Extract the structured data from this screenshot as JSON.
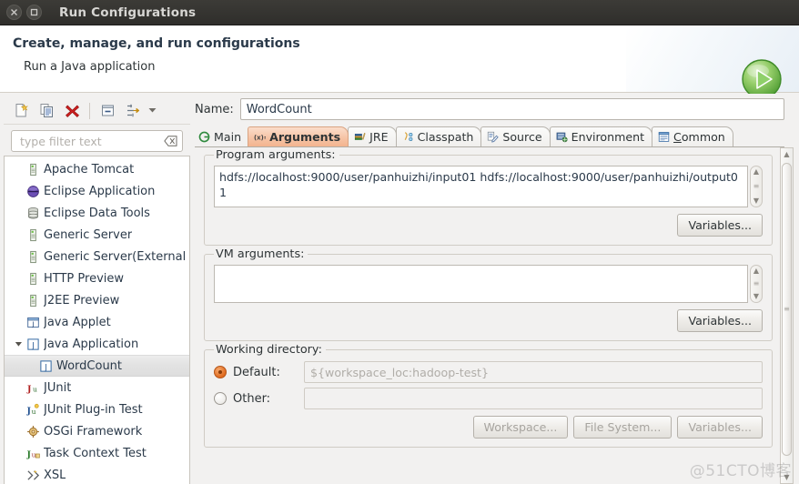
{
  "window": {
    "title": "Run Configurations",
    "close_icon": "close-icon",
    "maximize_icon": "maximize-icon"
  },
  "header": {
    "title": "Create, manage, and run configurations",
    "subtitle": "Run a Java application",
    "banner_icon": "run-play-icon"
  },
  "toolbar": {
    "buttons": [
      {
        "name": "new-configuration",
        "icon": "new-document-icon"
      },
      {
        "name": "duplicate-configuration",
        "icon": "copy-icon"
      },
      {
        "name": "delete-configuration",
        "icon": "red-x-delete-icon"
      },
      {
        "name": "collapse-all",
        "icon": "collapse-all-icon"
      },
      {
        "name": "filter-configurations",
        "icon": "filter-icon"
      }
    ],
    "dropdown_icon": "chevron-down-icon"
  },
  "filter": {
    "placeholder": "type filter text",
    "value": "",
    "clear_icon": "clear-field-icon"
  },
  "tree": {
    "items": [
      {
        "label": "Apache Tomcat",
        "icon": "server-icon",
        "indent": 0,
        "twisty": "",
        "selected": false
      },
      {
        "label": "Eclipse Application",
        "icon": "eclipse-icon",
        "indent": 0,
        "twisty": "",
        "selected": false
      },
      {
        "label": "Eclipse Data Tools",
        "icon": "database-icon",
        "indent": 0,
        "twisty": "",
        "selected": false
      },
      {
        "label": "Generic Server",
        "icon": "server-icon",
        "indent": 0,
        "twisty": "",
        "selected": false
      },
      {
        "label": "Generic Server(External",
        "icon": "server-icon",
        "indent": 0,
        "twisty": "",
        "selected": false
      },
      {
        "label": "HTTP Preview",
        "icon": "server-icon",
        "indent": 0,
        "twisty": "",
        "selected": false
      },
      {
        "label": "J2EE Preview",
        "icon": "server-icon",
        "indent": 0,
        "twisty": "",
        "selected": false
      },
      {
        "label": "Java Applet",
        "icon": "java-applet-icon",
        "indent": 0,
        "twisty": "",
        "selected": false
      },
      {
        "label": "Java Application",
        "icon": "java-app-icon",
        "indent": 0,
        "twisty": "expanded",
        "selected": false
      },
      {
        "label": "WordCount",
        "icon": "java-app-icon",
        "indent": 1,
        "twisty": "",
        "selected": true
      },
      {
        "label": "JUnit",
        "icon": "junit-icon",
        "indent": 0,
        "twisty": "",
        "selected": false
      },
      {
        "label": "JUnit Plug-in Test",
        "icon": "junit-plugin-icon",
        "indent": 0,
        "twisty": "",
        "selected": false
      },
      {
        "label": "OSGi Framework",
        "icon": "osgi-icon",
        "indent": 0,
        "twisty": "",
        "selected": false
      },
      {
        "label": "Task Context Test",
        "icon": "task-context-icon",
        "indent": 0,
        "twisty": "",
        "selected": false
      },
      {
        "label": "XSL",
        "icon": "xsl-icon",
        "indent": 0,
        "twisty": "",
        "selected": false
      }
    ]
  },
  "config": {
    "name_label": "Name:",
    "name_value": "WordCount",
    "tabs": [
      {
        "label": "Main",
        "icon": "main-icon",
        "active": false
      },
      {
        "label": "Arguments",
        "icon": "arguments-icon",
        "active": true
      },
      {
        "label": "JRE",
        "icon": "jre-icon",
        "active": false
      },
      {
        "label": "Classpath",
        "icon": "classpath-icon",
        "active": false
      },
      {
        "label": "Source",
        "icon": "source-icon",
        "active": false
      },
      {
        "label": "Environment",
        "icon": "environment-icon",
        "active": false
      },
      {
        "label": "Common",
        "icon": "common-icon",
        "active": false
      }
    ],
    "program_arguments": {
      "legend": "Program arguments:",
      "value": "hdfs://localhost:9000/user/panhuizhi/input01 hdfs://localhost:9000/user/panhuizhi/output01",
      "variables_button": "Variables..."
    },
    "vm_arguments": {
      "legend": "VM arguments:",
      "value": "",
      "variables_button": "Variables..."
    },
    "working_directory": {
      "legend": "Working directory:",
      "default_label": "Default:",
      "default_value": "${workspace_loc:hadoop-test}",
      "default_selected": true,
      "other_label": "Other:",
      "other_value": "",
      "other_selected": false,
      "workspace_button": "Workspace...",
      "filesystem_button": "File System...",
      "variables_button": "Variables..."
    }
  },
  "watermark": "@51CTO博客",
  "colors": {
    "titlebar": "#32312e",
    "active_tab": "#f3b48f",
    "accent_radio": "#e06b1f",
    "tree_text": "#2b3a4a"
  }
}
